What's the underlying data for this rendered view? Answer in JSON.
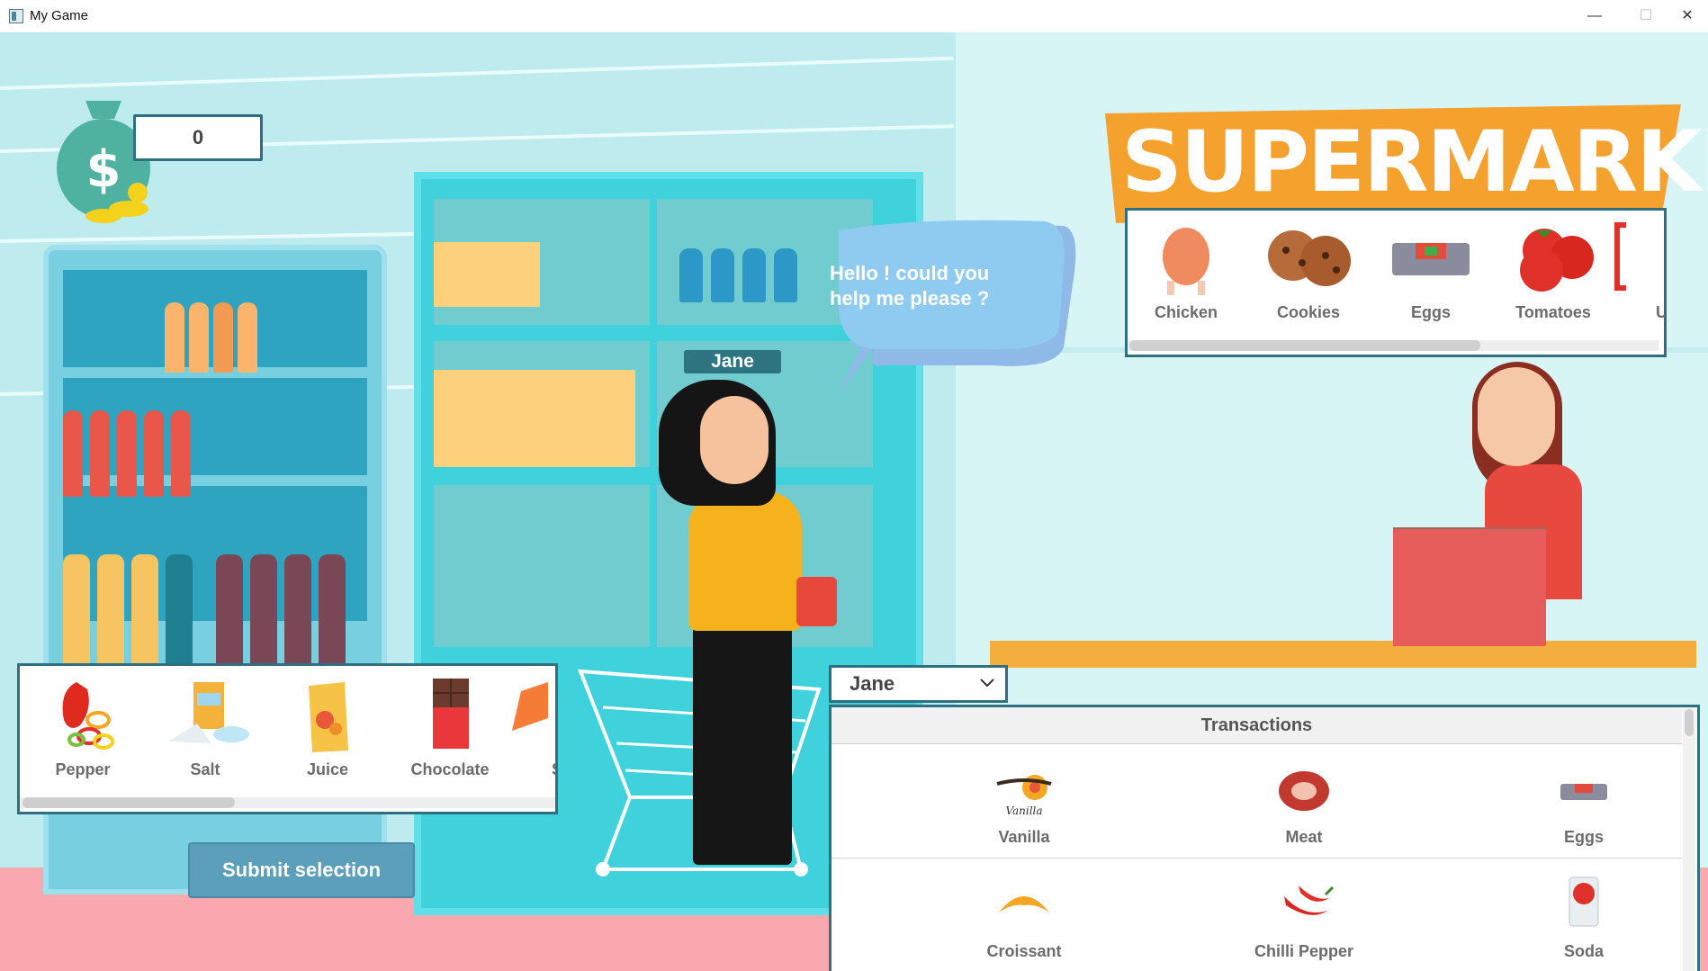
{
  "window": {
    "title": "My Game",
    "minimize": "—",
    "maximize": "☐",
    "close": "✕"
  },
  "money": {
    "amount": "0",
    "icon": "money-bag-icon"
  },
  "logo": {
    "text": "SUPERMARKET",
    "color": "#f4a12e"
  },
  "npc": {
    "name": "Jane",
    "speech": "Hello ! could you help me  please ?"
  },
  "shelf_top": {
    "items": [
      {
        "label": "Chicken",
        "icon": "chicken-icon"
      },
      {
        "label": "Cookies",
        "icon": "cookies-icon"
      },
      {
        "label": "Eggs",
        "icon": "eggs-icon"
      },
      {
        "label": "Tomatoes",
        "icon": "tomatoes-icon"
      },
      {
        "label": "Un",
        "icon": "partial-item-icon"
      }
    ]
  },
  "shelf_bottom": {
    "items": [
      {
        "label": "Pepper",
        "icon": "pepper-icon"
      },
      {
        "label": "Salt",
        "icon": "salt-icon"
      },
      {
        "label": "Juice",
        "icon": "juice-icon"
      },
      {
        "label": "Chocolate",
        "icon": "chocolate-icon"
      },
      {
        "label": "Sa",
        "icon": "partial-item-icon"
      }
    ]
  },
  "submit_label": "Submit selection",
  "customer_select": {
    "value": "Jane"
  },
  "transactions": {
    "title": "Transactions",
    "rows": [
      [
        {
          "label": "Vanilla",
          "icon": "vanilla-icon"
        },
        {
          "label": "Meat",
          "icon": "meat-icon"
        },
        {
          "label": "Eggs",
          "icon": "eggs-icon"
        }
      ],
      [
        {
          "label": "Croissant",
          "icon": "croissant-icon"
        },
        {
          "label": "Chilli Pepper",
          "icon": "chilli-pepper-icon"
        },
        {
          "label": "Soda",
          "icon": "soda-icon"
        }
      ]
    ]
  },
  "colors": {
    "accent": "#2f6f80",
    "button": "#5b9fbb",
    "floor": "#f8a8ae",
    "counter": "#f4ae3e"
  }
}
